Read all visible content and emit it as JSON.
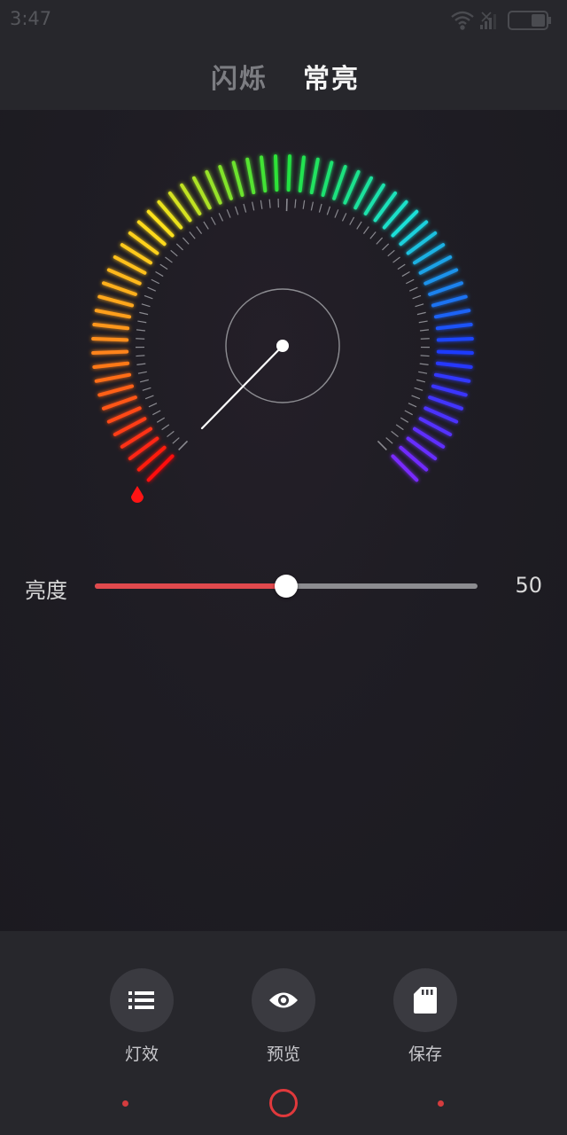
{
  "status_bar": {
    "time": "3:47",
    "icons": [
      "wifi-icon",
      "signal-icon",
      "battery-icon"
    ]
  },
  "header": {
    "tabs": [
      {
        "label": "闪烁",
        "active": false
      },
      {
        "label": "常亮",
        "active": true
      }
    ]
  },
  "dial": {
    "spectrum": [
      "#ff1010",
      "#ff8a1a",
      "#ffe21a",
      "#22e33a",
      "#1ae0d8",
      "#1a3cff",
      "#7a2aff"
    ],
    "start_marker_color": "#ff1414"
  },
  "brightness": {
    "label": "亮度",
    "value": "50",
    "level": 0.5,
    "fill_color": "#e0494d"
  },
  "actions": [
    {
      "label": "灯效",
      "icon": "list-icon"
    },
    {
      "label": "预览",
      "icon": "eye-icon"
    },
    {
      "label": "保存",
      "icon": "sd-card-icon"
    }
  ],
  "colors": {
    "accent": "#e0393c",
    "background": "#1c1b21",
    "bar": "#27272c"
  }
}
